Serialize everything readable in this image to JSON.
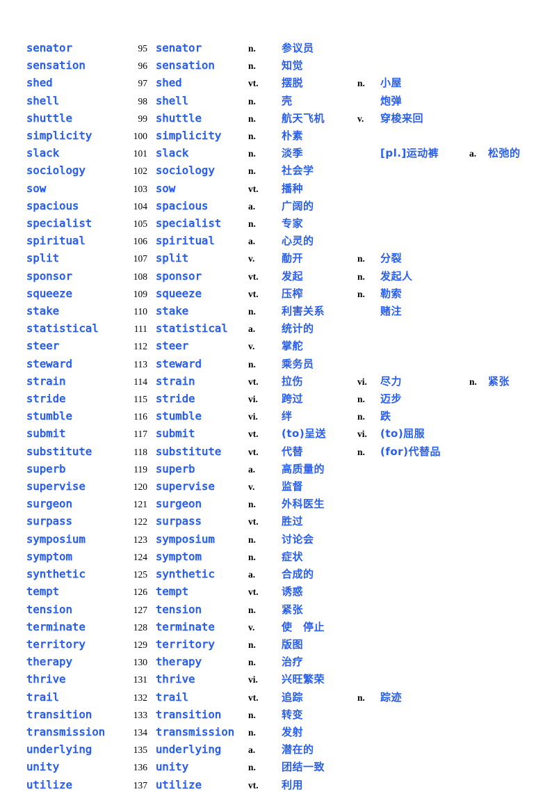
{
  "page": {
    "title": "English-Chinese Vocabulary List",
    "text_color_english": "#2a5fe8",
    "text_color_chinese": "#2a5fe8",
    "text_color_number": "#000000",
    "background": "#ffffff"
  },
  "rows": [
    {
      "word": "senator",
      "num": "95",
      "word2": "senator",
      "pos1": "n.",
      "def1": "参议员",
      "pos2": "",
      "def2": "",
      "pos3": "",
      "def3": ""
    },
    {
      "word": "sensation",
      "num": "96",
      "word2": "sensation",
      "pos1": "n.",
      "def1": "知觉",
      "pos2": "",
      "def2": "",
      "pos3": "",
      "def3": ""
    },
    {
      "word": "shed",
      "num": "97",
      "word2": "shed",
      "pos1": "vt.",
      "def1": "摆脱",
      "pos2": "n.",
      "def2": "小屋",
      "pos3": "",
      "def3": ""
    },
    {
      "word": "shell",
      "num": "98",
      "word2": "shell",
      "pos1": "n.",
      "def1": "壳",
      "pos2": "",
      "def2": "炮弹",
      "pos3": "",
      "def3": ""
    },
    {
      "word": "shuttle",
      "num": "99",
      "word2": "shuttle",
      "pos1": "n.",
      "def1": "航天飞机",
      "pos2": "v.",
      "def2": "穿梭来回",
      "pos3": "",
      "def3": ""
    },
    {
      "word": "simplicity",
      "num": "100",
      "word2": "simplicity",
      "pos1": "n.",
      "def1": "朴素",
      "pos2": "",
      "def2": "",
      "pos3": "",
      "def3": ""
    },
    {
      "word": "slack",
      "num": "101",
      "word2": "slack",
      "pos1": "n.",
      "def1": "淡季",
      "pos2": "",
      "def2": "[pl.]运动裤",
      "pos3": "a.",
      "def3": "松弛的"
    },
    {
      "word": "sociology",
      "num": "102",
      "word2": "sociology",
      "pos1": "n.",
      "def1": "社会学",
      "pos2": "",
      "def2": "",
      "pos3": "",
      "def3": ""
    },
    {
      "word": "sow",
      "num": "103",
      "word2": "sow",
      "pos1": "vt.",
      "def1": "播种",
      "pos2": "",
      "def2": "",
      "pos3": "",
      "def3": ""
    },
    {
      "word": "spacious",
      "num": "104",
      "word2": "spacious",
      "pos1": "a.",
      "def1": "广阔的",
      "pos2": "",
      "def2": "",
      "pos3": "",
      "def3": ""
    },
    {
      "word": "specialist",
      "num": "105",
      "word2": "specialist",
      "pos1": "n.",
      "def1": "专家",
      "pos2": "",
      "def2": "",
      "pos3": "",
      "def3": ""
    },
    {
      "word": "spiritual",
      "num": "106",
      "word2": "spiritual",
      "pos1": "a.",
      "def1": "心灵的",
      "pos2": "",
      "def2": "",
      "pos3": "",
      "def3": ""
    },
    {
      "word": "split",
      "num": "107",
      "word2": "split",
      "pos1": "v.",
      "def1": "勈开",
      "pos2": "n.",
      "def2": "分裂",
      "pos3": "",
      "def3": ""
    },
    {
      "word": "sponsor",
      "num": "108",
      "word2": "sponsor",
      "pos1": "vt.",
      "def1": "发起",
      "pos2": "n.",
      "def2": "发起人",
      "pos3": "",
      "def3": ""
    },
    {
      "word": "squeeze",
      "num": "109",
      "word2": "squeeze",
      "pos1": "vt.",
      "def1": "压榨",
      "pos2": "n.",
      "def2": "勒索",
      "pos3": "",
      "def3": ""
    },
    {
      "word": "stake",
      "num": "110",
      "word2": "stake",
      "pos1": "n.",
      "def1": "利害关系",
      "pos2": "",
      "def2": "赌注",
      "pos3": "",
      "def3": ""
    },
    {
      "word": "statistical",
      "num": "111",
      "word2": "statistical",
      "pos1": "a.",
      "def1": "统计的",
      "pos2": "",
      "def2": "",
      "pos3": "",
      "def3": ""
    },
    {
      "word": "steer",
      "num": "112",
      "word2": "steer",
      "pos1": "v.",
      "def1": "掌舵",
      "pos2": "",
      "def2": "",
      "pos3": "",
      "def3": ""
    },
    {
      "word": "steward",
      "num": "113",
      "word2": "steward",
      "pos1": "n.",
      "def1": "乘务员",
      "pos2": "",
      "def2": "",
      "pos3": "",
      "def3": ""
    },
    {
      "word": "strain",
      "num": "114",
      "word2": "strain",
      "pos1": "vt.",
      "def1": "拉伤",
      "pos2": "vi.",
      "def2": "尽力",
      "pos3": "n.",
      "def3": "紧张"
    },
    {
      "word": "stride",
      "num": "115",
      "word2": "stride",
      "pos1": "vi.",
      "def1": "跨过",
      "pos2": "n.",
      "def2": "迈步",
      "pos3": "",
      "def3": ""
    },
    {
      "word": "stumble",
      "num": "116",
      "word2": "stumble",
      "pos1": "vi.",
      "def1": "绊",
      "pos2": "n.",
      "def2": "跌",
      "pos3": "",
      "def3": ""
    },
    {
      "word": "submit",
      "num": "117",
      "word2": "submit",
      "pos1": "vt.",
      "def1": "(to)呈送",
      "pos2": "vi.",
      "def2": "(to)屈服",
      "pos3": "",
      "def3": ""
    },
    {
      "word": "substitute",
      "num": "118",
      "word2": "substitute",
      "pos1": "vt.",
      "def1": "代替",
      "pos2": "n.",
      "def2": "(for)代替品",
      "pos3": "",
      "def3": ""
    },
    {
      "word": "superb",
      "num": "119",
      "word2": "superb",
      "pos1": "a.",
      "def1": "高质量的",
      "pos2": "",
      "def2": "",
      "pos3": "",
      "def3": ""
    },
    {
      "word": "supervise",
      "num": "120",
      "word2": "supervise",
      "pos1": "v.",
      "def1": "监督",
      "pos2": "",
      "def2": "",
      "pos3": "",
      "def3": ""
    },
    {
      "word": "surgeon",
      "num": "121",
      "word2": "surgeon",
      "pos1": "n.",
      "def1": "外科医生",
      "pos2": "",
      "def2": "",
      "pos3": "",
      "def3": ""
    },
    {
      "word": "surpass",
      "num": "122",
      "word2": "surpass",
      "pos1": "vt.",
      "def1": "胜过",
      "pos2": "",
      "def2": "",
      "pos3": "",
      "def3": ""
    },
    {
      "word": "symposium",
      "num": "123",
      "word2": "symposium",
      "pos1": "n.",
      "def1": "讨论会",
      "pos2": "",
      "def2": "",
      "pos3": "",
      "def3": ""
    },
    {
      "word": "symptom",
      "num": "124",
      "word2": "symptom",
      "pos1": "n.",
      "def1": "症状",
      "pos2": "",
      "def2": "",
      "pos3": "",
      "def3": ""
    },
    {
      "word": "synthetic",
      "num": "125",
      "word2": "synthetic",
      "pos1": "a.",
      "def1": "合成的",
      "pos2": "",
      "def2": "",
      "pos3": "",
      "def3": ""
    },
    {
      "word": "tempt",
      "num": "126",
      "word2": "tempt",
      "pos1": "vt.",
      "def1": "诱惑",
      "pos2": "",
      "def2": "",
      "pos3": "",
      "def3": ""
    },
    {
      "word": "tension",
      "num": "127",
      "word2": "tension",
      "pos1": "n.",
      "def1": "紧张",
      "pos2": "",
      "def2": "",
      "pos3": "",
      "def3": ""
    },
    {
      "word": "terminate",
      "num": "128",
      "word2": "terminate",
      "pos1": "v.",
      "def1": "使　停止",
      "pos2": "",
      "def2": "",
      "pos3": "",
      "def3": ""
    },
    {
      "word": "territory",
      "num": "129",
      "word2": "territory",
      "pos1": "n.",
      "def1": "版图",
      "pos2": "",
      "def2": "",
      "pos3": "",
      "def3": ""
    },
    {
      "word": "therapy",
      "num": "130",
      "word2": "therapy",
      "pos1": "n.",
      "def1": "治疗",
      "pos2": "",
      "def2": "",
      "pos3": "",
      "def3": ""
    },
    {
      "word": "thrive",
      "num": "131",
      "word2": "thrive",
      "pos1": "vi.",
      "def1": "兴旺繁荣",
      "pos2": "",
      "def2": "",
      "pos3": "",
      "def3": ""
    },
    {
      "word": "trail",
      "num": "132",
      "word2": "trail",
      "pos1": "vt.",
      "def1": "追踪",
      "pos2": "n.",
      "def2": "踪迹",
      "pos3": "",
      "def3": ""
    },
    {
      "word": "transition",
      "num": "133",
      "word2": "transition",
      "pos1": "n.",
      "def1": "转变",
      "pos2": "",
      "def2": "",
      "pos3": "",
      "def3": ""
    },
    {
      "word": "transmission",
      "num": "134",
      "word2": "transmission",
      "pos1": "n.",
      "def1": "发射",
      "pos2": "",
      "def2": "",
      "pos3": "",
      "def3": ""
    },
    {
      "word": "underlying",
      "num": "135",
      "word2": "underlying",
      "pos1": "a.",
      "def1": "潜在的",
      "pos2": "",
      "def2": "",
      "pos3": "",
      "def3": ""
    },
    {
      "word": "unity",
      "num": "136",
      "word2": "unity",
      "pos1": "n.",
      "def1": "团结一致",
      "pos2": "",
      "def2": "",
      "pos3": "",
      "def3": ""
    },
    {
      "word": "utilize",
      "num": "137",
      "word2": "utilize",
      "pos1": "vt.",
      "def1": "利用",
      "pos2": "",
      "def2": "",
      "pos3": "",
      "def3": ""
    }
  ]
}
